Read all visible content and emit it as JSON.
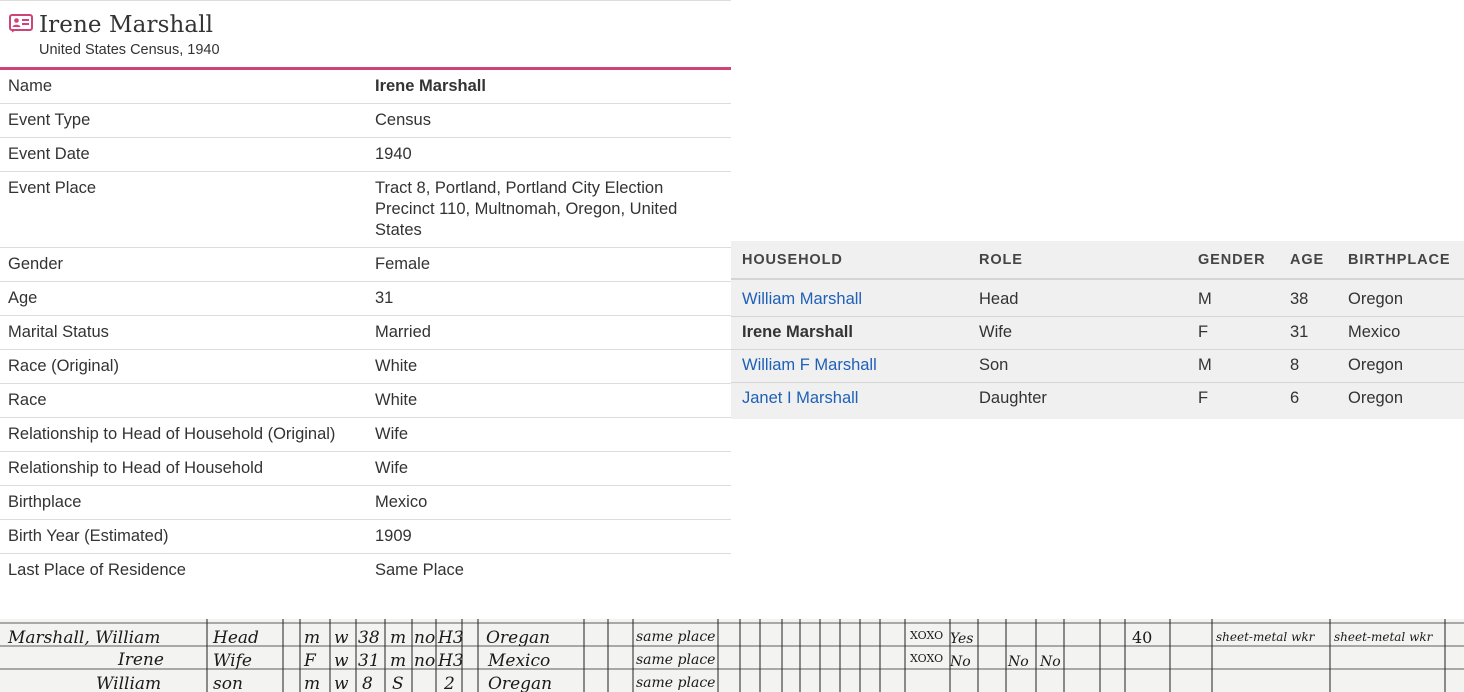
{
  "record": {
    "title": "Irene Marshall",
    "subtitle": "United States Census, 1940",
    "icon": "person-card-icon",
    "accent_color": "#cf4377"
  },
  "facts": [
    {
      "label": "Name",
      "value": "Irene Marshall",
      "emphasis": true
    },
    {
      "label": "Event Type",
      "value": "Census"
    },
    {
      "label": "Event Date",
      "value": "1940"
    },
    {
      "label": "Event Place",
      "value": "Tract 8, Portland, Portland City Election Precinct 110, Multnomah, Oregon, United States"
    },
    {
      "label": "Gender",
      "value": "Female"
    },
    {
      "label": "Age",
      "value": "31"
    },
    {
      "label": "Marital Status",
      "value": "Married"
    },
    {
      "label": "Race (Original)",
      "value": "White"
    },
    {
      "label": "Race",
      "value": "White"
    },
    {
      "label": "Relationship to Head of Household (Original)",
      "value": "Wife"
    },
    {
      "label": "Relationship to Head of Household",
      "value": "Wife"
    },
    {
      "label": "Birthplace",
      "value": "Mexico"
    },
    {
      "label": "Birth Year (Estimated)",
      "value": "1909"
    },
    {
      "label": "Last Place of Residence",
      "value": "Same Place"
    }
  ],
  "household": {
    "columns": {
      "household": "HOUSEHOLD",
      "role": "ROLE",
      "gender": "GENDER",
      "age": "AGE",
      "birthplace": "BIRTHPLACE"
    },
    "link_color": "#1f60b8",
    "rows": [
      {
        "name": "William Marshall",
        "role": "Head",
        "gender": "M",
        "age": "38",
        "birthplace": "Oregon",
        "is_link": true
      },
      {
        "name": "Irene Marshall",
        "role": "Wife",
        "gender": "F",
        "age": "31",
        "birthplace": "Mexico",
        "is_link": false
      },
      {
        "name": "William F Marshall",
        "role": "Son",
        "gender": "M",
        "age": "8",
        "birthplace": "Oregon",
        "is_link": true
      },
      {
        "name": "Janet I Marshall",
        "role": "Daughter",
        "gender": "F",
        "age": "6",
        "birthplace": "Oregon",
        "is_link": true
      }
    ]
  },
  "census_image": {
    "handwritten_rows": [
      [
        "Marshall, William",
        "Head",
        "M",
        "W",
        "38",
        "M",
        "no",
        "H3",
        "Oregan",
        "same place",
        "Yes",
        "40",
        "sheet metal wkr",
        "sheet metal wkr"
      ],
      [
        "Irene",
        "Wife",
        "F",
        "W",
        "31",
        "M",
        "no",
        "H3",
        "Mexico",
        "same place",
        "No",
        "No",
        "No"
      ],
      [
        "William",
        "son",
        "M",
        "W",
        "8",
        "S",
        "2",
        "Oregan",
        "same place"
      ]
    ]
  }
}
